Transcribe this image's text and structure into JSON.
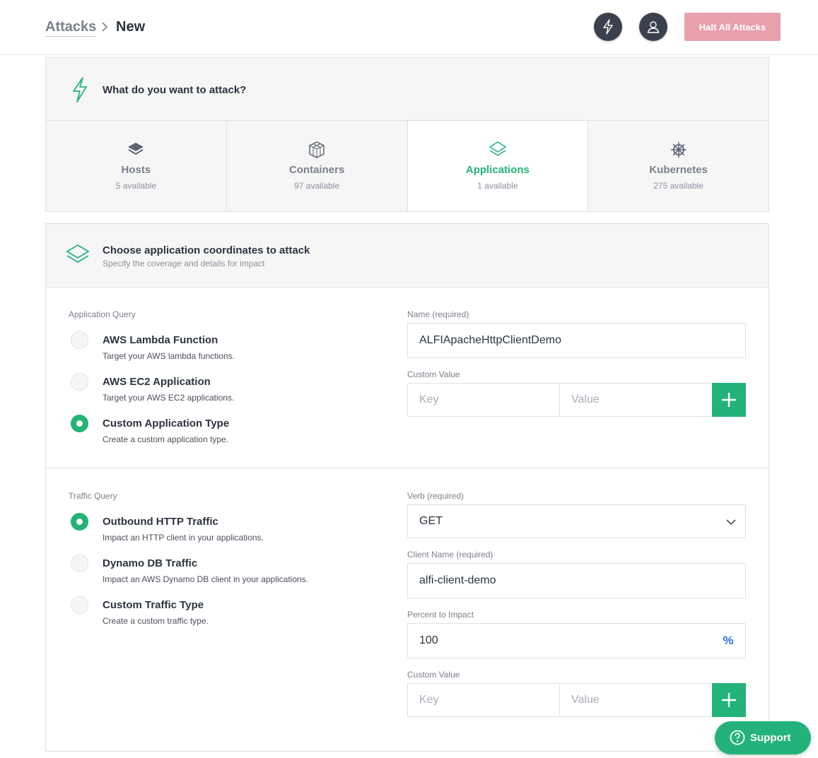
{
  "breadcrumb": {
    "parent": "Attacks",
    "current": "New"
  },
  "header": {
    "halt_label": "Halt All Attacks"
  },
  "target_panel": {
    "title": "What do you want to attack?",
    "targets": [
      {
        "name": "Hosts",
        "count": "5 available",
        "icon": "layers-icon"
      },
      {
        "name": "Containers",
        "count": "97 available",
        "icon": "cube-icon"
      },
      {
        "name": "Applications",
        "count": "1 available",
        "icon": "stack-icon",
        "selected": true
      },
      {
        "name": "Kubernetes",
        "count": "275 available",
        "icon": "helm-wheel-icon"
      }
    ]
  },
  "coords_panel": {
    "title": "Choose application coordinates to attack",
    "subtitle": "Specify the coverage and details for impact",
    "app_query": {
      "label": "Application Query",
      "options": [
        {
          "title": "AWS Lambda Function",
          "desc": "Target your AWS lambda functions.",
          "checked": false
        },
        {
          "title": "AWS EC2 Application",
          "desc": "Target your AWS EC2 applications.",
          "checked": false
        },
        {
          "title": "Custom Application Type",
          "desc": "Create a custom application type.",
          "checked": true
        }
      ],
      "name_label": "Name (required)",
      "name_value": "ALFIApacheHttpClientDemo",
      "custom_label": "Custom Value",
      "key_placeholder": "Key",
      "value_placeholder": "Value"
    },
    "traffic_query": {
      "label": "Traffic Query",
      "options": [
        {
          "title": "Outbound HTTP Traffic",
          "desc": "Impact an HTTP client in your applications.",
          "checked": true
        },
        {
          "title": "Dynamo DB Traffic",
          "desc": "Impact an AWS Dynamo DB client in your applications.",
          "checked": false
        },
        {
          "title": "Custom Traffic Type",
          "desc": "Create a custom traffic type.",
          "checked": false
        }
      ],
      "verb_label": "Verb (required)",
      "verb_value": "GET",
      "client_label": "Client Name (required)",
      "client_value": "alfi-client-demo",
      "percent_label": "Percent to Impact",
      "percent_value": "100",
      "percent_suffix": "%",
      "custom_label": "Custom Value",
      "key_placeholder": "Key",
      "value_placeholder": "Value"
    }
  },
  "support": {
    "label": "Support"
  },
  "colors": {
    "accent": "#23b37a",
    "danger_muted": "#e8a0aa",
    "dark": "#3b414c",
    "link_blue": "#2a6fd1"
  }
}
